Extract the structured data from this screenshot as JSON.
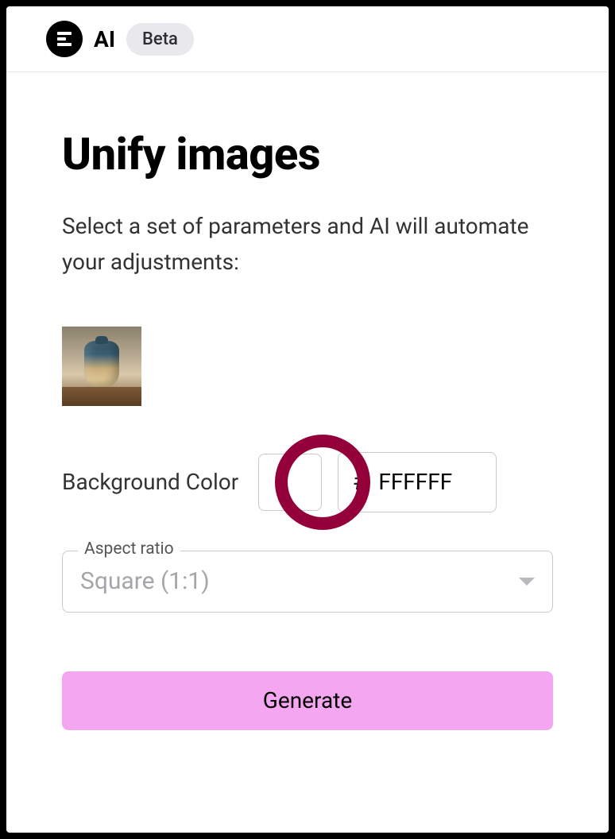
{
  "header": {
    "title": "AI",
    "badge": "Beta"
  },
  "page": {
    "title": "Unify images",
    "subtitle": "Select a set of parameters and AI will automate your adjustments:"
  },
  "form": {
    "background_label": "Background Color",
    "hex_prefix": "#",
    "hex_value": "FFFFFF",
    "aspect_legend": "Aspect ratio",
    "aspect_value": "Square (1:1)",
    "generate_label": "Generate"
  },
  "annotation": {
    "ring_color": "#93003a"
  }
}
